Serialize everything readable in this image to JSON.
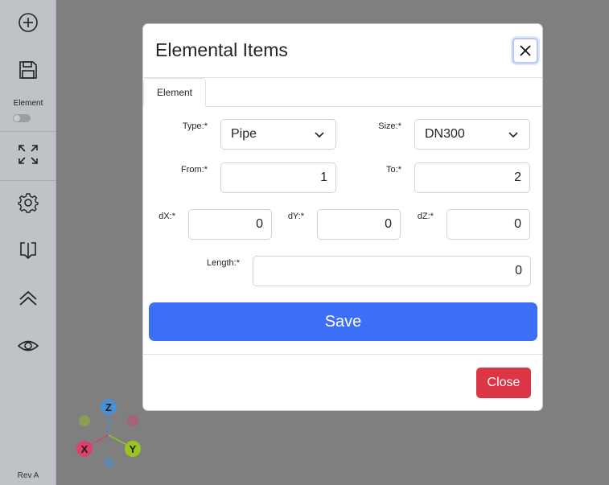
{
  "sidebar": {
    "icons": [
      "add-circle-icon",
      "save-icon",
      "expand-icon",
      "gear-icon",
      "download-icon",
      "double-chevron-up-icon",
      "eye-icon"
    ],
    "element_label": "Element",
    "element_toggle_on": false,
    "revision": "Rev A"
  },
  "axis_gizmo": {
    "axes": {
      "x": "X",
      "y": "Y",
      "z": "Z"
    },
    "colors": {
      "x": "#d8426b",
      "y": "#9bc41e",
      "z": "#4a8fd4"
    }
  },
  "modal": {
    "title": "Elemental Items",
    "close_icon": "close-icon",
    "tabs": [
      {
        "label": "Element",
        "active": true
      }
    ],
    "form": {
      "type": {
        "label": "Type:*",
        "value": "Pipe"
      },
      "size": {
        "label": "Size:*",
        "value": "DN300"
      },
      "from": {
        "label": "From:*",
        "value": "1"
      },
      "to": {
        "label": "To:*",
        "value": "2"
      },
      "dx": {
        "label": "dX:*",
        "value": "0"
      },
      "dy": {
        "label": "dY:*",
        "value": "0"
      },
      "dz": {
        "label": "dZ:*",
        "value": "0"
      },
      "length": {
        "label": "Length:*",
        "value": "0"
      }
    },
    "save_label": "Save",
    "close_label": "Close"
  },
  "colors": {
    "primary": "#3d6ef7",
    "danger": "#dc3545",
    "backdrop": "#7f7f7f",
    "sidebar": "#bfc2c6"
  }
}
